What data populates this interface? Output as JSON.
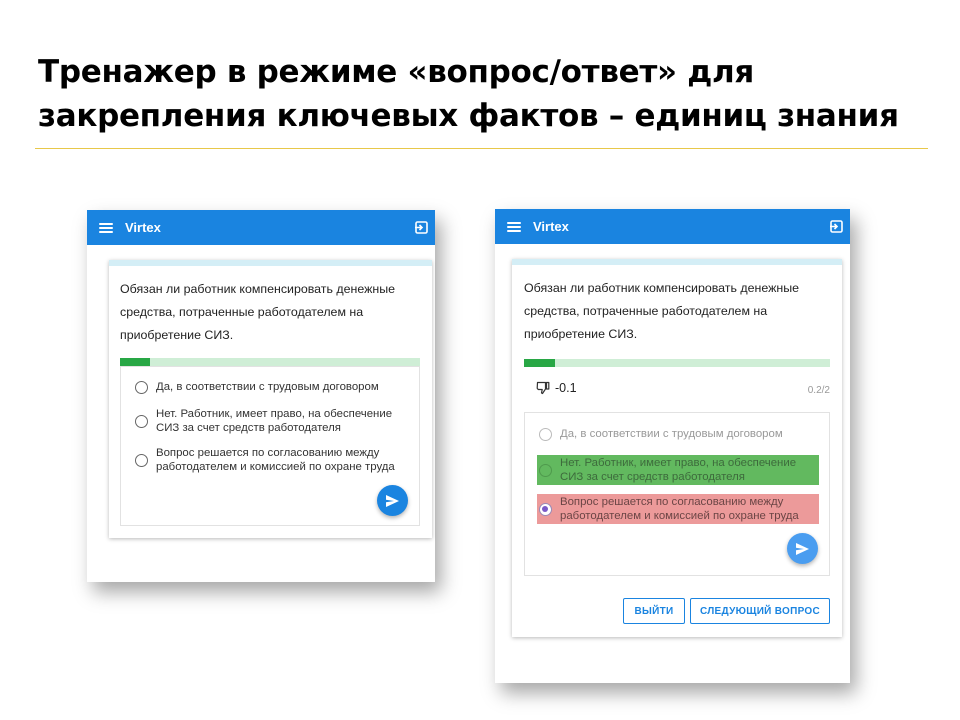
{
  "slide": {
    "title_line1": "Тренажер в режиме «вопрос/ответ» для",
    "title_line2": "закрепления ключевых фактов  – единиц знания"
  },
  "colors": {
    "appbar": "#1a84e0",
    "progress_track": "#cfeed6",
    "progress_fill": "#28a745",
    "correct_highlight": "#62b95f",
    "wrong_highlight": "#ec9a9a",
    "title_rule": "#e8c84a"
  },
  "left_screen": {
    "app_title": "Virtex",
    "menu_icon": "menu-icon",
    "exit_icon": "exit-icon",
    "question": "Обязан ли работник компенсировать денежные средства, потраченные работодателем на приобретение СИЗ.",
    "progress_fraction": 0.1,
    "options": [
      {
        "label": "Да, в соответствии с трудовым договором",
        "state": "unselected"
      },
      {
        "label": "Нет. Работник, имеет право, на обеспечение СИЗ за счет средств работодателя",
        "state": "unselected"
      },
      {
        "label": "Вопрос решается по согласованию между работодателем и комиссией по охране труда",
        "state": "unselected"
      }
    ],
    "send_icon": "send-icon"
  },
  "right_screen": {
    "app_title": "Virtex",
    "menu_icon": "menu-icon",
    "exit_icon": "exit-icon",
    "question": "Обязан ли работник компенсировать денежные средства, потраченные работодателем на приобретение СИЗ.",
    "progress_fraction": 0.1,
    "score_icon": "thumbs-down-icon",
    "score": "-0.1",
    "counter": "0.2/2",
    "options": [
      {
        "label": "Да, в соответствии с трудовым договором",
        "state": "disabled"
      },
      {
        "label": "Нет. Работник, имеет право, на обеспечение СИЗ за счет средств работодателя",
        "state": "correct"
      },
      {
        "label": "Вопрос решается по согласованию между работодателем и комиссией по охране труда",
        "state": "selected-wrong"
      }
    ],
    "send_icon": "send-icon",
    "exit_button": "ВЫЙТИ",
    "next_button": "СЛЕДУЮЩИЙ ВОПРОС"
  }
}
